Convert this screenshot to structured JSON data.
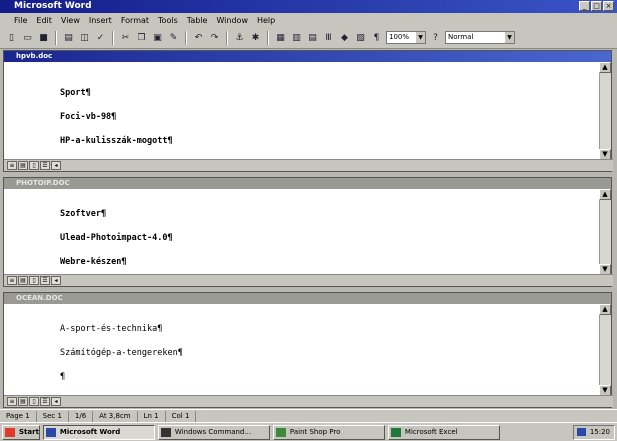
{
  "app": {
    "title": "Microsoft Word"
  },
  "menu": [
    "File",
    "Edit",
    "View",
    "Insert",
    "Format",
    "Tools",
    "Table",
    "Window",
    "Help"
  ],
  "toolbar": {
    "zoom": "100%",
    "style": "Normal"
  },
  "documents": [
    {
      "title": "hpvb.doc",
      "lines": [
        "Sport¶",
        "Foci-vb-98¶",
        "HP-a-kulisszák-mogott¶"
      ]
    },
    {
      "title": "PHOTOIP.DOC",
      "lines": [
        "Szoftver¶",
        "Ulead-Photoimpact-4.0¶",
        "Webre-készen¶"
      ]
    },
    {
      "title": "OCEAN.DOC",
      "lines": [
        "A-sport-és-technika¶",
        "Számítógép-a-tengereken¶",
        "¶"
      ]
    }
  ],
  "status": {
    "page": "Page 1",
    "sec": "Sec 1",
    "pages": "1/6",
    "at": "At 3,8cm",
    "ln": "Ln 1",
    "col": "Col 1"
  },
  "taskbar": {
    "start": "Start",
    "tasks": [
      "Microsoft Word",
      "Windows Command...",
      "Paint Shop Pro",
      "Microsoft Excel"
    ],
    "clock": "15:20"
  }
}
